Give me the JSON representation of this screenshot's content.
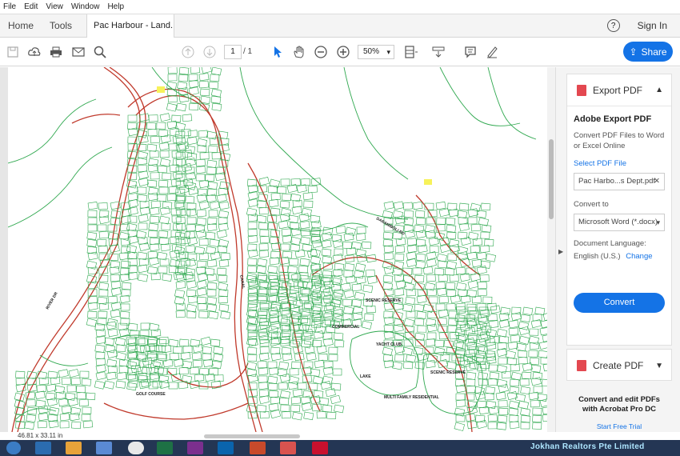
{
  "menu": [
    "File",
    "Edit",
    "View",
    "Window",
    "Help"
  ],
  "tabs": {
    "home": "Home",
    "tools": "Tools",
    "document": "Pac Harbour - Land...",
    "sign_in": "Sign In",
    "help": "?"
  },
  "toolbar": {
    "page_current": "1",
    "page_total": "/ 1",
    "zoom": "50%",
    "share": "Share"
  },
  "panel": {
    "export_pdf": "Export PDF",
    "adobe_export_title": "Adobe Export PDF",
    "description": "Convert PDF Files to Word or Excel Online",
    "select_file": "Select PDF File",
    "file_name": "Pac Harbo...s Dept.pdf",
    "convert_to_label": "Convert to",
    "convert_to_value": "Microsoft Word (*.docx)",
    "doc_lang_label": "Document Language:",
    "doc_lang_value": "English (U.S.)",
    "change": "Change",
    "convert_button": "Convert",
    "create_pdf": "Create PDF",
    "promo": "Convert and edit PDFs with Acrobat Pro DC",
    "trial": "Start Free Trial"
  },
  "status": {
    "dimensions": "46.81 x 33.11 in"
  },
  "map_labels": [
    "GOLF COURSE",
    "COMMERCIAL",
    "SCENIC RESERVE",
    "YACHT CLUB",
    "LAKE",
    "MULTI FAMILY RESIDENTIAL",
    "SCENIC RESERVE",
    "RIVER DR",
    "CANAL",
    "DARANIBOLI RD"
  ],
  "taskbar": {
    "brand": "Jokhan Realtors Pte Limited"
  },
  "colors": {
    "accent": "#1473e6",
    "parcel_green": "#2fa84f",
    "road_red": "#c0392b"
  }
}
